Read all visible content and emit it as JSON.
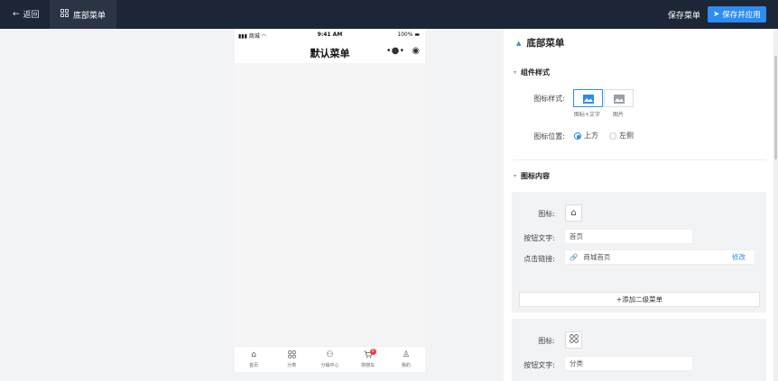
{
  "header": {
    "back_label": "返回",
    "crumb_label": "底部菜单",
    "save_label": "保存菜单",
    "save_publish_label": "保存并应用"
  },
  "phone": {
    "status": {
      "carrier": "商城",
      "time": "9:41 AM",
      "battery": "100%"
    },
    "nav_title": "默认菜单",
    "tabs": [
      {
        "label": "首页",
        "icon": "home-icon",
        "glyph": "⌂"
      },
      {
        "label": "分类",
        "icon": "category-icon",
        "glyph": "⠶"
      },
      {
        "label": "分销中心",
        "icon": "distribution-icon",
        "glyph": "⚇"
      },
      {
        "label": "购物车",
        "icon": "cart-icon",
        "glyph": "🛒",
        "badge": "0"
      },
      {
        "label": "我的",
        "icon": "user-icon",
        "glyph": "♙"
      }
    ]
  },
  "panel": {
    "title": "底部菜单",
    "style_section": "组件样式",
    "icon_style_label": "图标样式:",
    "icon_style_options": [
      "图标+文字",
      "图片"
    ],
    "icon_position_label": "图标位置:",
    "icon_position_options": [
      "上方",
      "左侧"
    ],
    "content_section": "图标内容",
    "items": [
      {
        "icon_label": "图标:",
        "icon": "home-icon",
        "text_label": "按钮文字:",
        "text_value": "首页",
        "link_label": "点击链接:",
        "link_value": "商城首页",
        "edit_label": "修改",
        "add_sub_label": "+添加二级菜单"
      },
      {
        "icon_label": "图标:",
        "icon": "category-icon",
        "text_label": "按钮文字:",
        "text_value": "分类"
      }
    ]
  },
  "colors": {
    "accent": "#2d8cf0",
    "topbar": "#1d2636"
  }
}
